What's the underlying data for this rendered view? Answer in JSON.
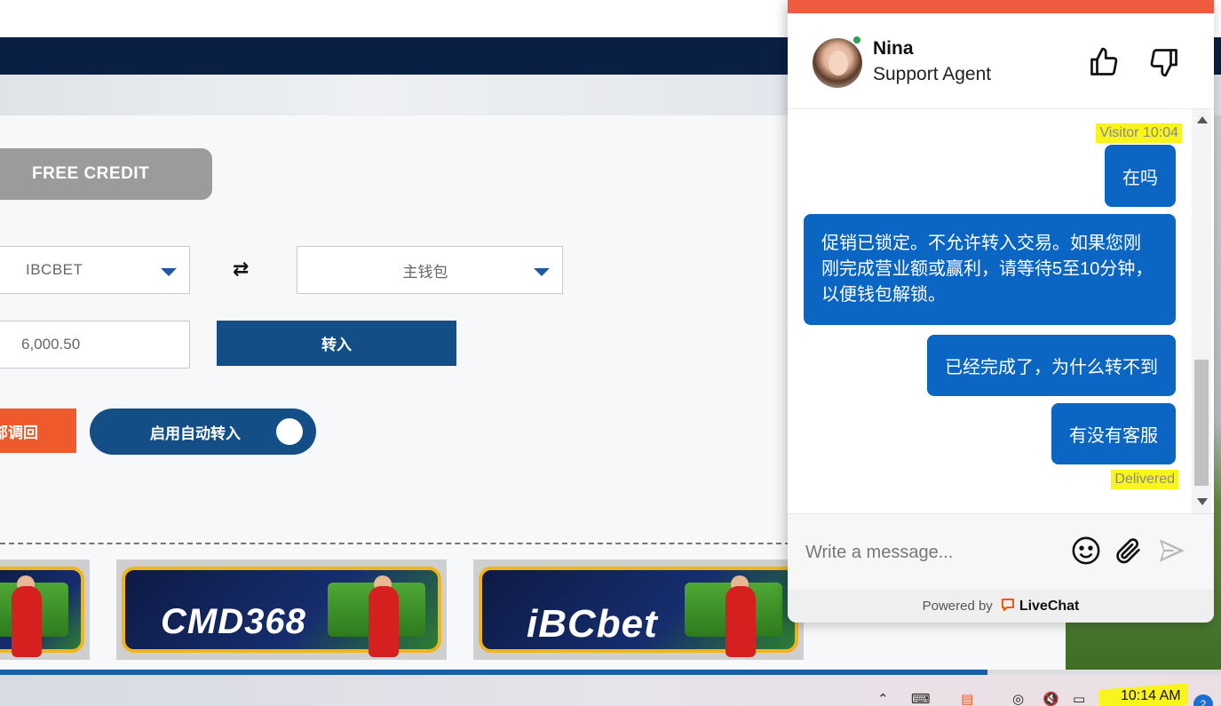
{
  "page": {
    "free_credit_label": "FREE CREDIT",
    "from_wallet": "IBCBET",
    "to_wallet": "主钱包",
    "swap_icon": "⇄",
    "amount_value": "6,000.50",
    "transfer_label": "转入",
    "recall_label": "部调回",
    "auto_transfer_label": "启用自动转入",
    "auto_transfer_enabled": true,
    "games": [
      {
        "logo": ""
      },
      {
        "logo": "CMD368"
      },
      {
        "logo": "iBCbet"
      }
    ],
    "scroll_progress_percent": 81
  },
  "chat": {
    "accent_color": "#f05a40",
    "agent": {
      "name": "Nina",
      "role": "Support Agent",
      "status": "online"
    },
    "visitor_meta": "Visitor 10:04",
    "messages": [
      {
        "text": "在吗"
      },
      {
        "text": "促销已锁定。不允许转入交易。如果您刚刚完成营业额或赢利，请等待5至10分钟，以便钱包解锁。"
      },
      {
        "text": "已经完成了，为什么转不到"
      },
      {
        "text": "有没有客服"
      }
    ],
    "delivered_label": "Delivered",
    "input_placeholder": "Write a message...",
    "powered_by": "Powered by",
    "brand": "LiveChat",
    "bubble_color": "#0a66c2"
  },
  "taskbar": {
    "clock": "10:14 AM",
    "notification_count": "2"
  }
}
